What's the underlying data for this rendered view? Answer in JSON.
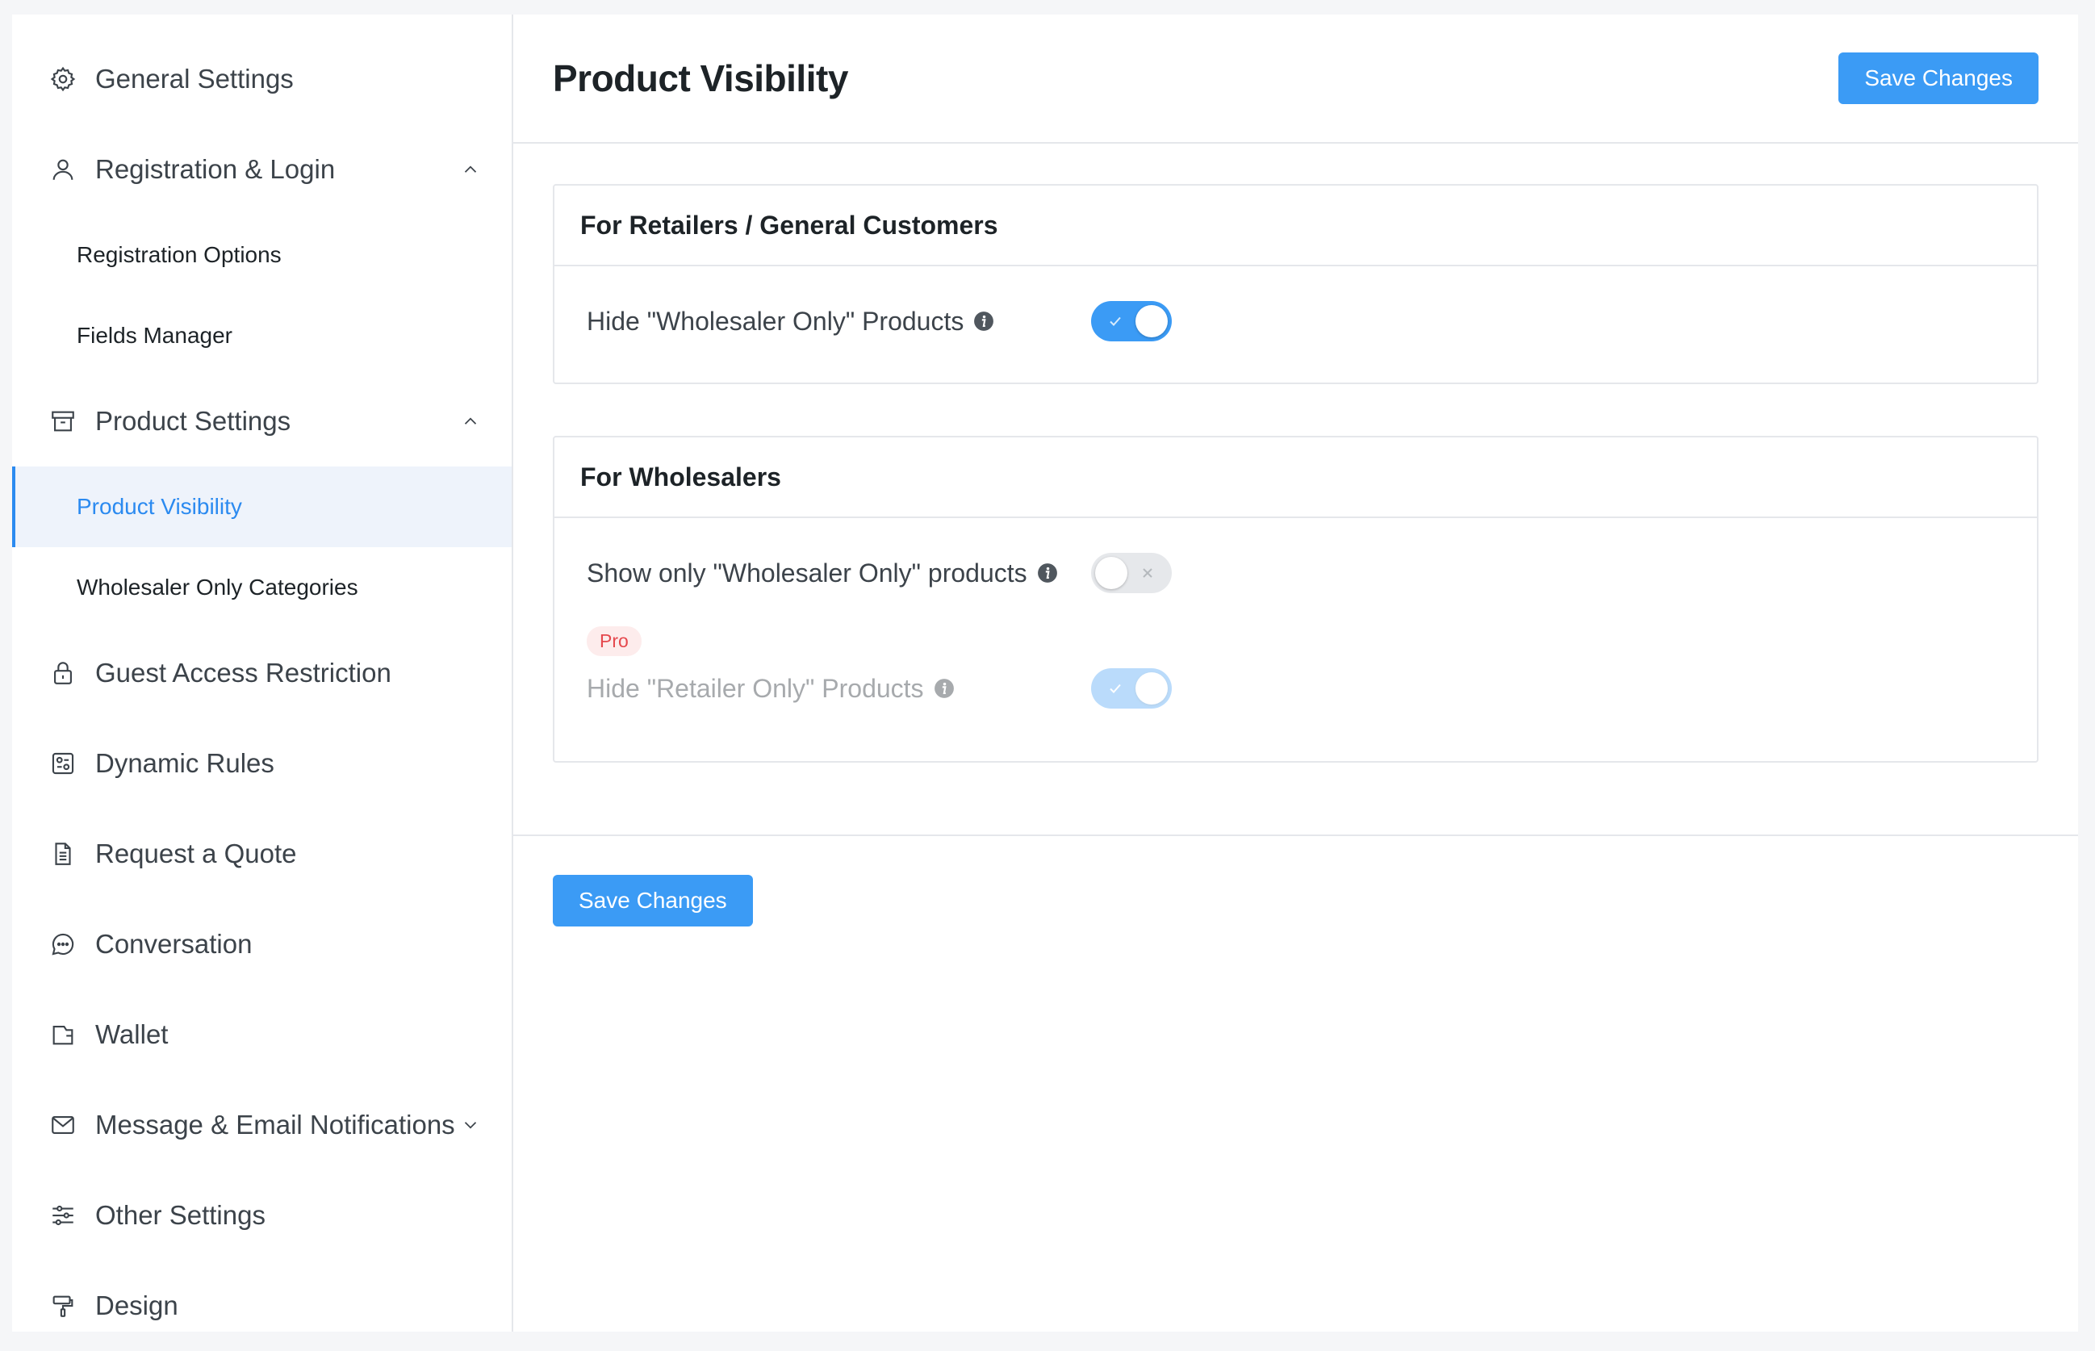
{
  "sidebar": {
    "items": [
      {
        "label": "General Settings"
      },
      {
        "label": "Registration & Login"
      },
      {
        "label": "Product Settings"
      },
      {
        "label": "Guest Access Restriction"
      },
      {
        "label": "Dynamic Rules"
      },
      {
        "label": "Request a Quote"
      },
      {
        "label": "Conversation"
      },
      {
        "label": "Wallet"
      },
      {
        "label": "Message & Email Notifications"
      },
      {
        "label": "Other Settings"
      },
      {
        "label": "Design"
      }
    ],
    "registration_sub": [
      {
        "label": "Registration Options"
      },
      {
        "label": "Fields Manager"
      }
    ],
    "product_sub": [
      {
        "label": "Product Visibility",
        "active": true
      },
      {
        "label": "Wholesaler Only Categories"
      }
    ]
  },
  "header": {
    "title": "Product Visibility",
    "save_label": "Save Changes"
  },
  "sections": {
    "retailers": {
      "title": "For Retailers / General Customers",
      "hide_wholesaler_label": "Hide \"Wholesaler Only\" Products",
      "hide_wholesaler_on": true
    },
    "wholesalers": {
      "title": "For Wholesalers",
      "show_only_label": "Show only \"Wholesaler Only\" products",
      "show_only_on": false,
      "pro_badge": "Pro",
      "hide_retailer_label": "Hide \"Retailer Only\" Products",
      "hide_retailer_on": true
    }
  },
  "footer": {
    "save_label": "Save Changes"
  },
  "colors": {
    "accent": "#3b9bf5",
    "active_bg": "#eef3fb",
    "pro_bg": "#fdecec",
    "pro_text": "#e5484d"
  }
}
